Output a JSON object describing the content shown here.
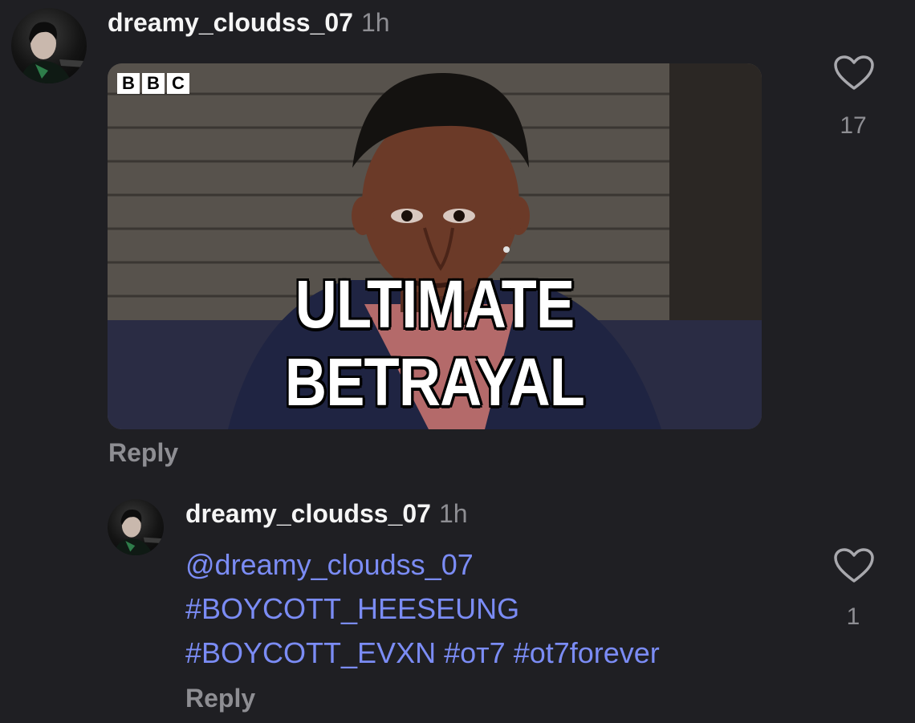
{
  "comment": {
    "username": "dreamy_cloudss_07",
    "time": "1h",
    "gif": {
      "logo_letters": [
        "B",
        "B",
        "C"
      ],
      "caption": "ULTIMATE BETRAYAL"
    },
    "reply_label": "Reply",
    "like_count": "17"
  },
  "reply": {
    "username": "dreamy_cloudss_07",
    "time": "1h",
    "mention": "@dreamy_cloudss_07",
    "hashtags_line1": "#BOYCOTT_HEESEUNG",
    "hashtags_line2": [
      "#BOYCOTT_EVXN",
      "#oт7",
      "#ot7forever"
    ],
    "reply_label": "Reply",
    "like_count": "1"
  },
  "colors": {
    "background": "#1f1f23",
    "link": "#7b8cf5",
    "muted": "#8e8e93"
  }
}
